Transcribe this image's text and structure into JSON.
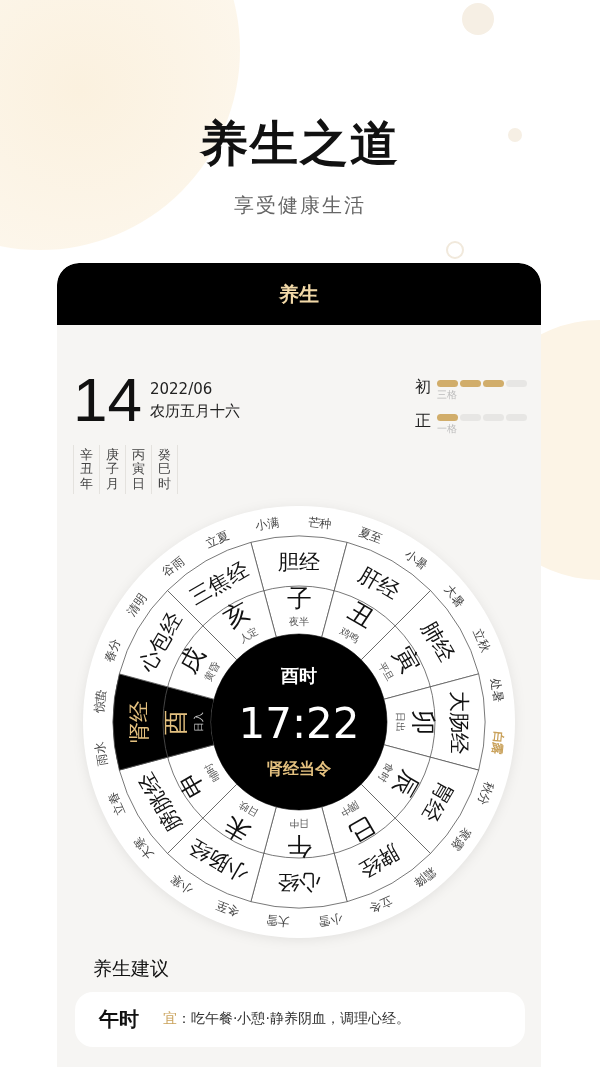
{
  "header": {
    "title": "养生之道",
    "subtitle": "享受健康生活"
  },
  "card": {
    "title": "养生"
  },
  "date": {
    "day": "14",
    "month": "2022/06",
    "lunar": "农历五月十六"
  },
  "ganzhi": [
    "辛丑年",
    "庚子月",
    "丙寅日",
    "癸巳时"
  ],
  "meters": [
    {
      "label": "初",
      "level": 0.75,
      "caption": "三格"
    },
    {
      "label": "正",
      "level": 0.25,
      "caption": "一格"
    }
  ],
  "wheel": {
    "center": {
      "period": "酉时",
      "time": "17:22",
      "note": "肾经当令"
    },
    "sectors": [
      {
        "branch": "子",
        "alias": "夜半",
        "meridian": "胆经",
        "selected": false
      },
      {
        "branch": "丑",
        "alias": "鸡鸣",
        "meridian": "肝经",
        "selected": false
      },
      {
        "branch": "寅",
        "alias": "平旦",
        "meridian": "肺经",
        "selected": false
      },
      {
        "branch": "卯",
        "alias": "日出",
        "meridian": "大肠经",
        "selected": false
      },
      {
        "branch": "辰",
        "alias": "食时",
        "meridian": "胃经",
        "selected": false
      },
      {
        "branch": "巳",
        "alias": "隅中",
        "meridian": "脾经",
        "selected": false
      },
      {
        "branch": "午",
        "alias": "日中",
        "meridian": "心经",
        "selected": false
      },
      {
        "branch": "未",
        "alias": "日昳",
        "meridian": "小肠经",
        "selected": false
      },
      {
        "branch": "申",
        "alias": "晡时",
        "meridian": "膀胱经",
        "selected": false
      },
      {
        "branch": "酉",
        "alias": "日入",
        "meridian": "肾经",
        "selected": true
      },
      {
        "branch": "戌",
        "alias": "黄昏",
        "meridian": "心包经",
        "selected": false
      },
      {
        "branch": "亥",
        "alias": "人定",
        "meridian": "三焦经",
        "selected": false
      }
    ],
    "solar_terms": [
      {
        "name": "芒种",
        "selected": false
      },
      {
        "name": "夏至",
        "selected": false
      },
      {
        "name": "小暑",
        "selected": false
      },
      {
        "name": "大暑",
        "selected": false
      },
      {
        "name": "立秋",
        "selected": false
      },
      {
        "name": "处暑",
        "selected": false
      },
      {
        "name": "白露",
        "selected": true
      },
      {
        "name": "秋分",
        "selected": false
      },
      {
        "name": "寒露",
        "selected": false
      },
      {
        "name": "霜降",
        "selected": false
      },
      {
        "name": "立冬",
        "selected": false
      },
      {
        "name": "小雪",
        "selected": false
      },
      {
        "name": "大雪",
        "selected": false
      },
      {
        "name": "冬至",
        "selected": false
      },
      {
        "name": "小寒",
        "selected": false
      },
      {
        "name": "大寒",
        "selected": false
      },
      {
        "name": "立春",
        "selected": false
      },
      {
        "name": "雨水",
        "selected": false
      },
      {
        "name": "惊蛰",
        "selected": false
      },
      {
        "name": "春分",
        "selected": false
      },
      {
        "name": "清明",
        "selected": false
      },
      {
        "name": "谷雨",
        "selected": false
      },
      {
        "name": "立夏",
        "selected": false
      },
      {
        "name": "小满",
        "selected": false
      }
    ]
  },
  "advice": {
    "title": "养生建议",
    "items": [
      {
        "period": "午时",
        "tag": "宜",
        "text": "：吃午餐·小憩·静养阴血，调理心经。"
      }
    ]
  }
}
